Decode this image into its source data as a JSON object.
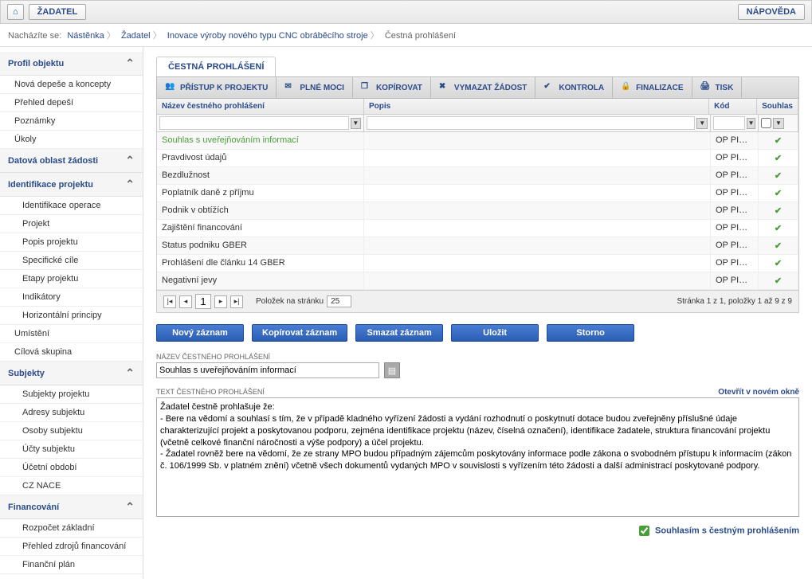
{
  "topbar": {
    "home": "⌂",
    "applicant": "ŽADATEL",
    "help": "NÁPOVĚDA"
  },
  "breadcrumb": {
    "label": "Nacházíte se:",
    "items": [
      "Nástěnka",
      "Žadatel",
      "Inovace výroby nového typu CNC obráběcího stroje",
      "Čestná prohlášení"
    ]
  },
  "sidebar": {
    "sections": [
      {
        "title": "Profil objektu",
        "items": [
          "Nová depeše a koncepty",
          "Přehled depeší",
          "Poznámky",
          "Úkoly"
        ]
      },
      {
        "title": "Datová oblast žádosti",
        "items": []
      },
      {
        "title": "Identifikace projektu",
        "items": [
          "Identifikace operace",
          "Projekt",
          "Popis projektu",
          "Specifické cíle",
          "Etapy projektu",
          "Indikátory",
          "Horizontální principy"
        ]
      },
      {
        "title": "",
        "plain_items": [
          "Umístění",
          "Cílová skupina"
        ]
      },
      {
        "title": "Subjekty",
        "items": [
          "Subjekty projektu",
          "Adresy subjektu",
          "Osoby subjektu",
          "Účty subjektu",
          "Účetní období",
          "CZ NACE"
        ]
      },
      {
        "title": "Financování",
        "items": [
          "Rozpočet základní",
          "Přehled zdrojů financování",
          "Finanční plán"
        ]
      }
    ]
  },
  "tab": {
    "title": "ČESTNÁ PROHLÁŠENÍ"
  },
  "toolbar": {
    "access": "PŘÍSTUP K PROJEKTU",
    "proxy": "PLNÉ MOCI",
    "copy": "KOPÍROVAT",
    "delete": "VYMAZAT ŽÁDOST",
    "check": "KONTROLA",
    "finalize": "FINALIZACE",
    "print": "TISK"
  },
  "grid": {
    "headers": {
      "name": "Název čestného prohlášení",
      "desc": "Popis",
      "code": "Kód",
      "agree": "Souhlas"
    },
    "rows": [
      {
        "name": "Souhlas s uveřejňováním informací",
        "desc": "",
        "code": "OP PIK_IN...",
        "agree": true,
        "selected": true
      },
      {
        "name": "Pravdivost údajů",
        "desc": "",
        "code": "OP PIK_IN...",
        "agree": true
      },
      {
        "name": "Bezdlužnost",
        "desc": "",
        "code": "OP PIK_IN...",
        "agree": true
      },
      {
        "name": "Poplatník daně z příjmu",
        "desc": "",
        "code": "OP PIK_IN...",
        "agree": true
      },
      {
        "name": "Podnik v obtížích",
        "desc": "",
        "code": "OP PIK_IN...",
        "agree": true
      },
      {
        "name": "Zajištění financování",
        "desc": "",
        "code": "OP PIK_IN...",
        "agree": true
      },
      {
        "name": "Status podniku GBER",
        "desc": "",
        "code": "OP PIK_IN...",
        "agree": true
      },
      {
        "name": "Prohlášení dle článku 14 GBER",
        "desc": "",
        "code": "OP PIK_IN...",
        "agree": true
      },
      {
        "name": "Negativní jevy",
        "desc": "",
        "code": "OP PIK_IN...",
        "agree": true
      }
    ],
    "footer": {
      "page": "1",
      "per_page_label": "Položek na stránku",
      "per_page": "25",
      "summary": "Stránka 1 z 1, položky 1 až 9 z 9"
    }
  },
  "actions": {
    "new": "Nový záznam",
    "copy": "Kopírovat záznam",
    "delete": "Smazat záznam",
    "save": "Uložit",
    "cancel": "Storno"
  },
  "form": {
    "name_label": "NÁZEV ČESTNÉHO PROHLÁŠENÍ",
    "name_value": "Souhlas s uveřejňováním informací",
    "text_label": "TEXT ČESTNÉHO PROHLÁŠENÍ",
    "open_new": "Otevřít v novém okně",
    "text_value": "Žadatel čestně prohlašuje že:\n- Bere na vědomí a souhlasí s tím, že v případě kladného vyřízení žádosti a vydání rozhodnutí o poskytnutí dotace budou zveřejněny příslušné údaje charakterizující projekt a poskytovanou podporu, zejména identifikace projektu (název, číselná označení), identifikace žadatele, struktura financování projektu (včetně celkové finanční náročnosti a výše podpory) a účel projektu.\n- Žadatel rovněž bere na vědomí, že ze strany MPO budou případným zájemcům poskytovány informace podle zákona o svobodném přístupu k informacím (zákon č. 106/1999 Sb. v platném znění) včetně všech dokumentů vydaných MPO v souvislosti s vyřízením této žádosti a další administrací poskytované podpory.",
    "agree_label": "Souhlasím s čestným prohlášením",
    "agree_checked": true
  }
}
